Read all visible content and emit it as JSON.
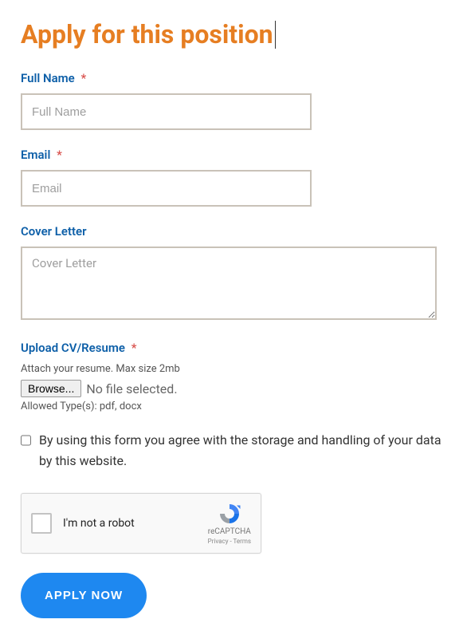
{
  "title": "Apply for this position",
  "fields": {
    "fullName": {
      "label": "Full Name",
      "required": "*",
      "placeholder": "Full Name"
    },
    "email": {
      "label": "Email",
      "required": "*",
      "placeholder": "Email"
    },
    "coverLetter": {
      "label": "Cover Letter",
      "placeholder": "Cover Letter"
    },
    "upload": {
      "label": "Upload CV/Resume",
      "required": "*",
      "hint": "Attach your resume. Max size 2mb",
      "browse": "Browse...",
      "status": "No file selected.",
      "allowed": "Allowed Type(s): pdf, docx"
    }
  },
  "consent": "By using this form you agree with the storage and handling of your data by this website.",
  "recaptcha": {
    "label": "I'm not a robot",
    "brand": "reCAPTCHA",
    "legal": "Privacy - Terms"
  },
  "submit": "APPLY NOW"
}
